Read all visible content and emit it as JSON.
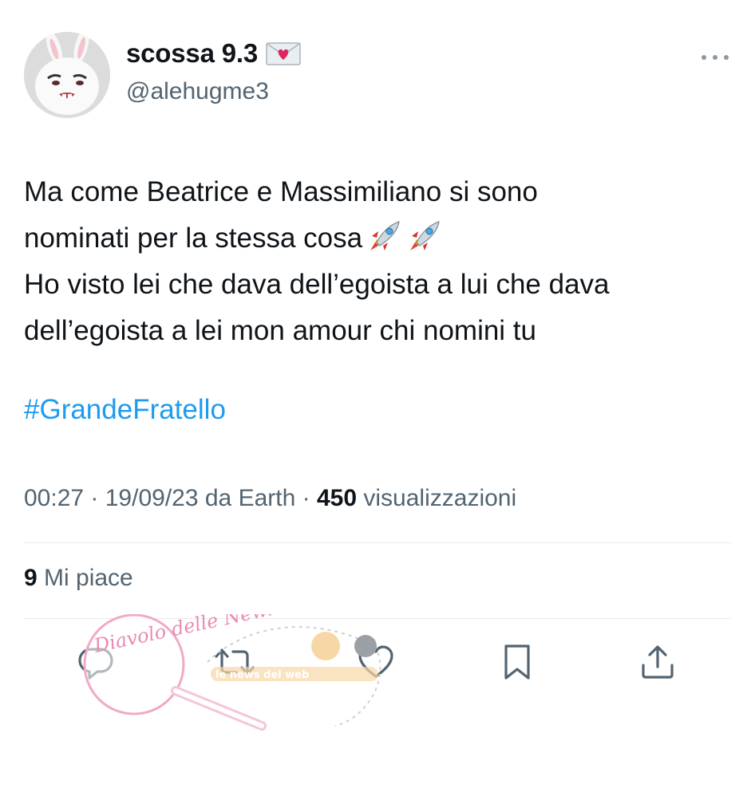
{
  "author": {
    "display_name": "scossa 9.3",
    "handle": "@alehugme3",
    "avatar_icon": "white-bunny-avatar",
    "name_emoji": "love-letter-icon"
  },
  "tweet": {
    "lines": [
      "Ma come Beatrice e Massimiliano si sono",
      "nominati per la stessa cosa",
      "Ho visto lei che dava dell’egoista a lui che dava",
      "dell’egoista a lei mon amour chi nomini tu"
    ],
    "emoji_after_line_2": [
      "rocket-icon",
      "rocket-icon"
    ],
    "hashtag": "#GrandeFratello"
  },
  "meta": {
    "time": "00:27",
    "date": "19/09/23",
    "source_prefix": "da",
    "source": "Earth",
    "views_count": "450",
    "views_label": "visualizzazioni"
  },
  "stats": {
    "likes_count": "9",
    "likes_label": "Mi piace"
  },
  "actions": [
    "reply-icon",
    "retweet-icon",
    "like-icon",
    "bookmark-icon",
    "share-icon"
  ],
  "watermarks": {
    "left_stamp": "Diavolo delle News",
    "right_stamp": "le news del web"
  },
  "colors": {
    "text": "#0f1419",
    "secondary": "#536471",
    "link": "#1d9bf0",
    "divider": "#e6e9ec",
    "watermark_pink": "#f2a8c8"
  }
}
